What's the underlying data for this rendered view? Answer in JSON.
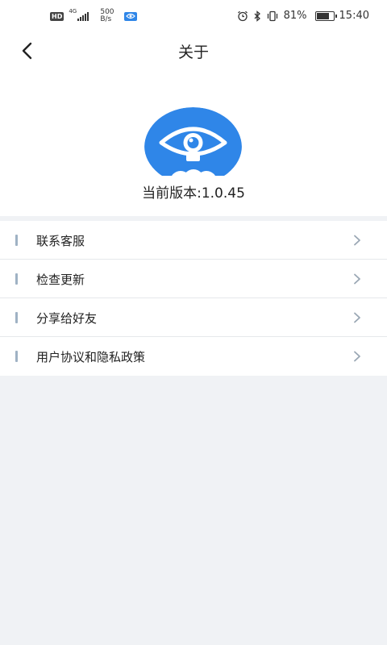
{
  "status_bar": {
    "hd": "HD",
    "network_gen": "4G",
    "net_speed_value": "500",
    "net_speed_unit": "B/s",
    "battery_percent": "81%",
    "battery_level": 0.81,
    "time": "15:40"
  },
  "header": {
    "title": "关于"
  },
  "app": {
    "version_label": "当前版本:1.0.45",
    "brand_color": "#2f86e8"
  },
  "menu": {
    "items": [
      {
        "label": "联系客服"
      },
      {
        "label": "检查更新"
      },
      {
        "label": "分享给好友"
      },
      {
        "label": "用户协议和隐私政策"
      }
    ]
  },
  "icons": {
    "back": "chevron-left-icon",
    "item_arrow": "chevron-right-icon",
    "app_logo": "eye-camera-logo"
  }
}
